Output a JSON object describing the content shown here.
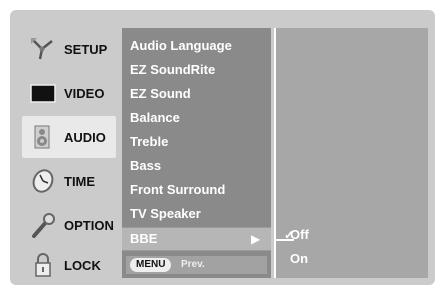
{
  "nav": {
    "items": [
      {
        "label": "SETUP",
        "icon": "antenna-icon"
      },
      {
        "label": "VIDEO",
        "icon": "tv-icon"
      },
      {
        "label": "AUDIO",
        "icon": "speaker-icon",
        "active": true
      },
      {
        "label": "TIME",
        "icon": "clock-icon"
      },
      {
        "label": "OPTION",
        "icon": "wrench-icon"
      },
      {
        "label": "LOCK",
        "icon": "lock-icon"
      }
    ]
  },
  "menu": {
    "items": [
      "Audio Language",
      "EZ SoundRite",
      "EZ Sound",
      "Balance",
      "Treble",
      "Bass",
      "Front Surround",
      "TV Speaker"
    ],
    "selected": "BBE",
    "selected_arrow": "▶",
    "footer": {
      "button": "MENU",
      "text": "Prev."
    }
  },
  "options": {
    "items": [
      "Off",
      "On"
    ],
    "checkmark": "✓"
  }
}
